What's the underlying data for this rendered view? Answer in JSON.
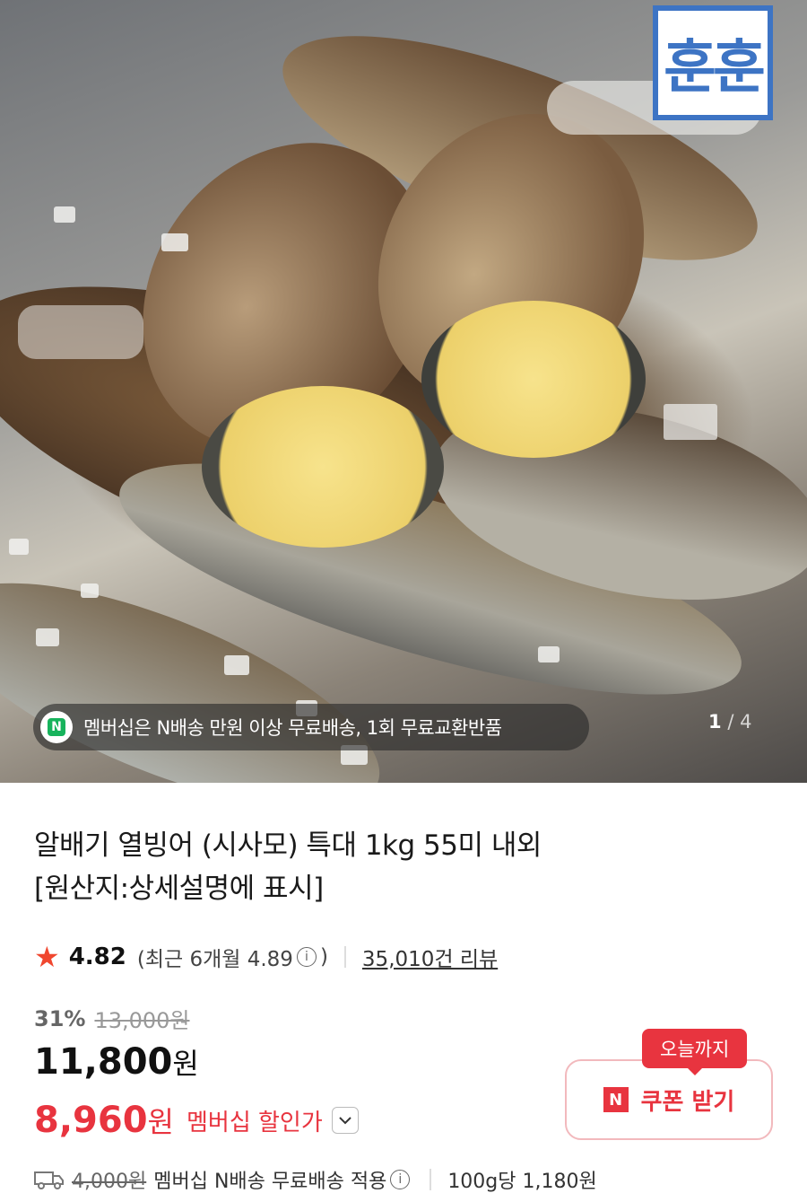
{
  "hero": {
    "brand_logo_text": "훈훈",
    "membership_banner": "멤버십은 N배송 만원 이상 무료배송, 1회 무료교환반품",
    "pager": {
      "current": "1",
      "separator": "/",
      "total": "4"
    }
  },
  "product": {
    "title_line1": "알배기 열빙어 (시사모) 특대 1kg 55미 내외",
    "title_line2": "[원산지:상세설명에 표시]"
  },
  "rating": {
    "value": "4.82",
    "recent_prefix": "(최근 6개월 4.89",
    "recent_suffix": ")",
    "reviews": "35,010건 리뷰"
  },
  "pricing": {
    "discount_rate": "31%",
    "original_price": "13,000원",
    "price_number": "11,800",
    "price_unit": "원",
    "member_price_number": "8,960",
    "member_price_unit": "원",
    "member_price_label": "멤버십 할인가"
  },
  "coupon": {
    "tag": "오늘까지",
    "n_badge": "N",
    "label": "쿠폰 받기"
  },
  "shipping": {
    "original_fee": "4,000원",
    "note": "멤버십 N배송 무료배송 적용",
    "unit_price": "100g당 1,180원"
  },
  "colors": {
    "accent_red": "#e8343f",
    "naver_green": "#17b35c",
    "logo_blue": "#3d74c4",
    "star": "#f0472f"
  }
}
